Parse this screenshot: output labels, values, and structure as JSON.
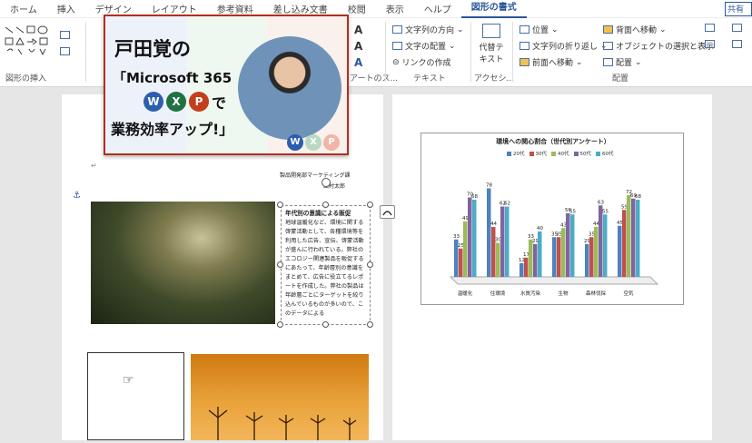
{
  "tabs": [
    "ホーム",
    "挿入",
    "デザイン",
    "レイアウト",
    "参考資料",
    "差し込み文書",
    "校閲",
    "表示",
    "ヘルプ",
    "図形の書式"
  ],
  "active_tab": "図形の書式",
  "share_label": "共有",
  "ribbon": {
    "group_insert_shapes": "図形の挿入",
    "group_wordart": "ワードアートのス...",
    "group_text": "テキスト",
    "group_access": "アクセシ...",
    "group_arrange": "配置",
    "text_direction": "文字列の方向",
    "text_align": "文字の配置",
    "create_link": "リンクの作成",
    "alt_text": "代替テキスト",
    "position": "位置",
    "wrap_text": "文字列の折り返し",
    "bring_forward": "前面へ移動",
    "send_backward": "背面へ移動",
    "selection_pane": "オブジェクトの選択と表示",
    "align": "配置"
  },
  "banner": {
    "line1": "戸田覚の",
    "line2": "「Microsoft 365",
    "line3_suffix": "で",
    "line4": "業務効率アップ!」",
    "apps": [
      "W",
      "X",
      "P"
    ],
    "corner_apps": [
      "W",
      "X",
      "P"
    ]
  },
  "doc": {
    "header_line1": "製品開発部マーケティング課",
    "header_line2": "山村太郎",
    "textbox_heading": "年代別の意識による販促",
    "textbox_body": "地球温暖化など、環境に関する啓蒙活動として、各種環境等を利用した広告、宣伝、啓蒙活動が盛んに行われている。弊社のエコロジー関連製品を販促するにあたって、年齢層別の意識をまとめて、広告に役立てるレポートを作成した。弊社の製品は年齢層ごとにターゲットを絞り込んでいるものが多いので、このデータによる"
  },
  "colors": {
    "accent": "#2b579a",
    "word": "#2b5fad",
    "excel": "#207245",
    "ppt": "#c43e1c"
  },
  "chart_data": {
    "type": "bar",
    "title": "環境への関心割合（世代別アンケート）",
    "categories": [
      "温暖化",
      "住環境",
      "水質汚染",
      "生物",
      "森林伐採",
      "空気"
    ],
    "series": [
      {
        "name": "20代",
        "values": [
          33,
          78,
          12,
          35,
          29,
          45
        ]
      },
      {
        "name": "30代",
        "values": [
          25,
          44,
          17,
          35,
          35,
          59
        ]
      },
      {
        "name": "40代",
        "values": [
          49,
          30,
          33,
          43,
          44,
          72
        ]
      },
      {
        "name": "50代",
        "values": [
          70,
          62,
          29,
          56,
          63,
          69
        ]
      },
      {
        "name": "60代",
        "values": [
          68,
          62,
          40,
          55,
          55,
          68
        ]
      }
    ],
    "series_colors": [
      "#4f81bd",
      "#c0504d",
      "#9bbb59",
      "#8064a2",
      "#4bacc6"
    ],
    "ylim": [
      0,
      80
    ]
  }
}
